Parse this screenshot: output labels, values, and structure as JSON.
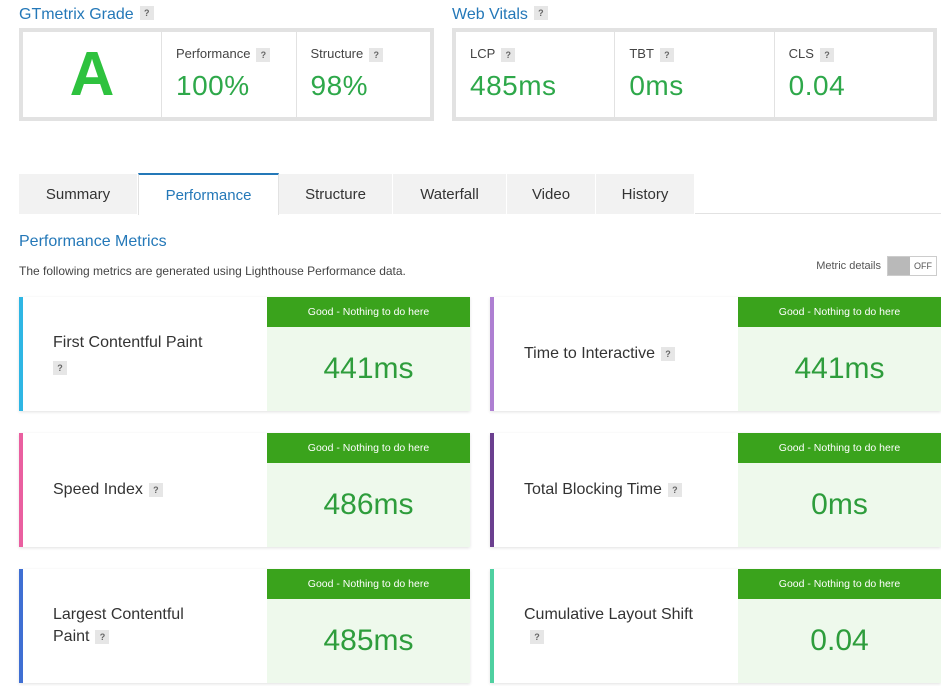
{
  "grade": {
    "title": "GTmetrix Grade",
    "letter": "A",
    "performance_label": "Performance",
    "performance_value": "100%",
    "structure_label": "Structure",
    "structure_value": "98%"
  },
  "vitals": {
    "title": "Web Vitals",
    "items": [
      {
        "label": "LCP",
        "value": "485ms"
      },
      {
        "label": "TBT",
        "value": "0ms"
      },
      {
        "label": "CLS",
        "value": "0.04"
      }
    ]
  },
  "help_icon": "?",
  "tabs": [
    "Summary",
    "Performance",
    "Structure",
    "Waterfall",
    "Video",
    "History"
  ],
  "active_tab": "Performance",
  "performance": {
    "title": "Performance Metrics",
    "description": "The following metrics are generated using Lighthouse Performance data.",
    "metric_details_label": "Metric details",
    "toggle_state": "OFF"
  },
  "metrics": [
    {
      "name": "First Contentful Paint",
      "status": "Good - Nothing to do here",
      "value": "441ms",
      "color": "#2fb6e4"
    },
    {
      "name": "Time to Interactive",
      "status": "Good - Nothing to do here",
      "value": "441ms",
      "color": "#ae7fd2"
    },
    {
      "name": "Speed Index",
      "status": "Good - Nothing to do here",
      "value": "486ms",
      "color": "#ea5fa0"
    },
    {
      "name": "Total Blocking Time",
      "status": "Good - Nothing to do here",
      "value": "0ms",
      "color": "#6b3f8f"
    },
    {
      "name": "Largest Contentful Paint",
      "status": "Good - Nothing to do here",
      "value": "485ms",
      "color": "#3f6fd3"
    },
    {
      "name": "Cumulative Layout Shift",
      "status": "Good - Nothing to do here",
      "value": "0.04",
      "color": "#4fd0a0"
    }
  ],
  "colors": {
    "accent": "#2478b8",
    "grade_green": "#2ec23e",
    "badge_green": "#3aa31c"
  }
}
